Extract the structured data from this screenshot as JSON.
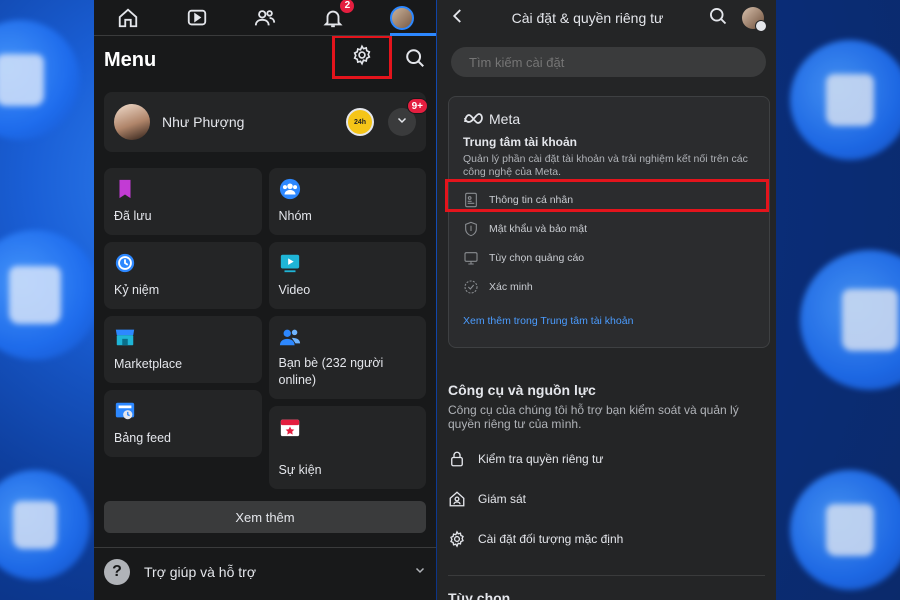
{
  "left": {
    "nav": {
      "notification_count": "2"
    },
    "menu_title": "Menu",
    "profile": {
      "name": "Như Phượng",
      "story_badge": "24h",
      "more_badge": "9+"
    },
    "tiles_left": [
      {
        "label": "Đã lưu",
        "icon": "bookmark-icon"
      },
      {
        "label": "Kỷ niệm",
        "icon": "memories-icon"
      },
      {
        "label": "Marketplace",
        "icon": "marketplace-icon"
      },
      {
        "label": "Bảng feed",
        "icon": "feed-icon"
      }
    ],
    "tiles_right": [
      {
        "label": "Nhóm",
        "icon": "groups-icon"
      },
      {
        "label": "Video",
        "icon": "video-icon"
      },
      {
        "label": "Bạn bè (232 người online)",
        "icon": "friends-icon"
      },
      {
        "label": "Sự kiện",
        "icon": "events-icon"
      }
    ],
    "see_more": "Xem thêm",
    "help": "Trợ giúp và hỗ trợ"
  },
  "right": {
    "title": "Cài đặt & quyền riêng tư",
    "search_placeholder": "Tìm kiếm cài đặt",
    "meta_card": {
      "logo": "Meta",
      "heading": "Trung tâm tài khoản",
      "description": "Quản lý phần cài đặt tài khoản và trải nghiệm kết nối trên các công nghệ của Meta.",
      "items": [
        "Thông tin cá nhân",
        "Mật khẩu và bảo mật",
        "Tùy chọn quảng cáo",
        "Xác minh"
      ],
      "link": "Xem thêm trong Trung tâm tài khoản"
    },
    "tools": {
      "title": "Công cụ và nguồn lực",
      "description": "Công cụ của chúng tôi hỗ trợ bạn kiểm soát và quản lý quyền riêng tư của mình.",
      "items": [
        "Kiểm tra quyền riêng tư",
        "Giám sát",
        "Cài đặt đối tượng mặc định"
      ]
    },
    "options_title": "Tùy chọn"
  },
  "colors": {
    "highlight": "#e4141c",
    "accent": "#2d88ff",
    "link": "#4b9cff",
    "badge": "#e41e3f"
  }
}
